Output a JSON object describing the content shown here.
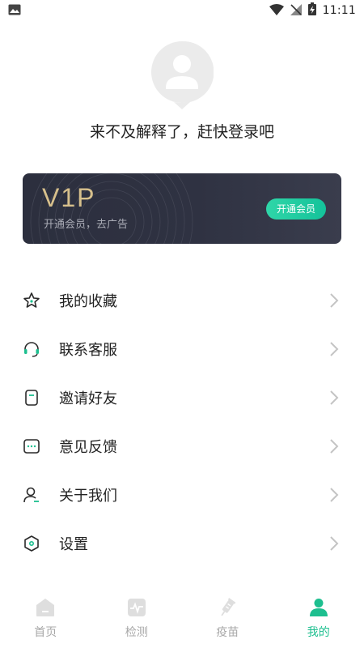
{
  "status_bar": {
    "time": "11:11"
  },
  "profile": {
    "login_prompt": "来不及解释了，赶快登录吧"
  },
  "vip": {
    "title": "V1P",
    "subtitle": "开通会员，去广告",
    "button_label": "开通会员",
    "accent_color": "#1dc79c",
    "gold_color": "#d7c08c"
  },
  "menu": {
    "items": [
      {
        "label": "我的收藏",
        "icon": "star-icon"
      },
      {
        "label": "联系客服",
        "icon": "headset-icon"
      },
      {
        "label": "邀请好友",
        "icon": "invite-icon"
      },
      {
        "label": "意见反馈",
        "icon": "feedback-icon"
      },
      {
        "label": "关于我们",
        "icon": "person-icon"
      },
      {
        "label": "设置",
        "icon": "settings-icon"
      }
    ]
  },
  "bottom_nav": {
    "items": [
      {
        "label": "首页",
        "icon": "home-icon"
      },
      {
        "label": "检测",
        "icon": "monitor-icon"
      },
      {
        "label": "疫苗",
        "icon": "syringe-icon"
      },
      {
        "label": "我的",
        "icon": "profile-icon",
        "active": true
      }
    ]
  },
  "colors": {
    "active": "#1dbf8f",
    "inactive": "#a8a8a8",
    "text": "#222222"
  }
}
